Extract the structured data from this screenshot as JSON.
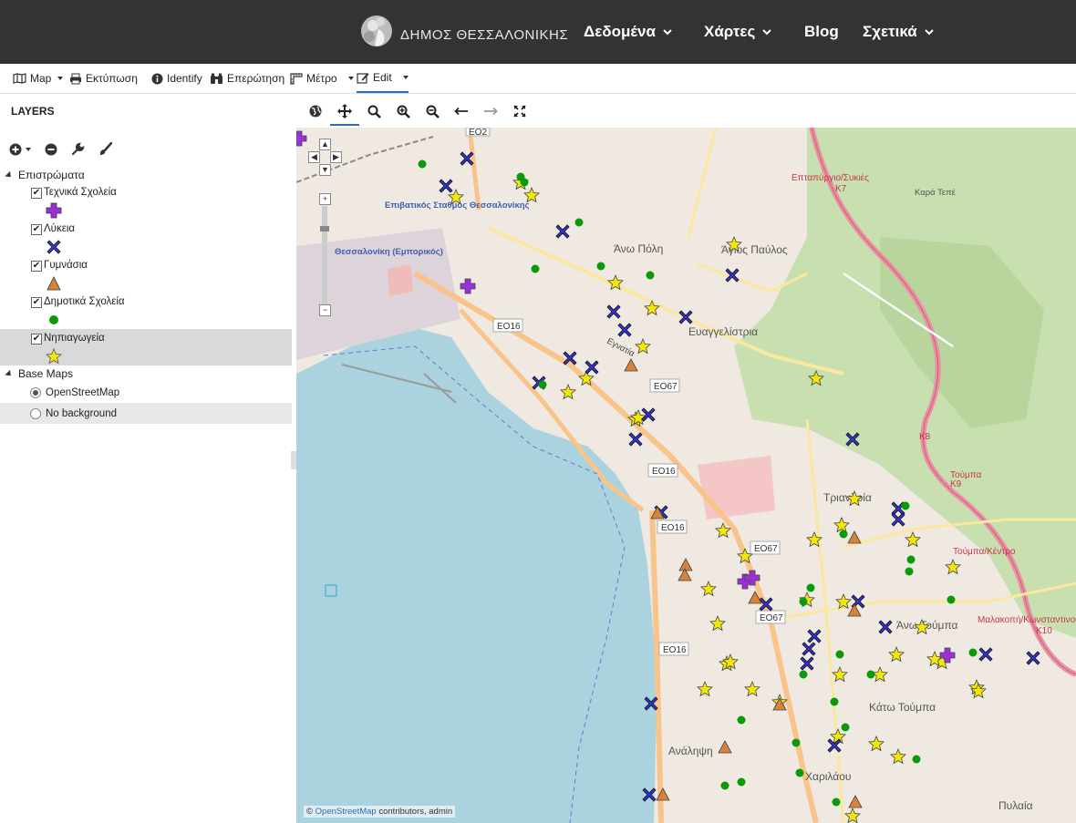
{
  "header": {
    "brand": "ΔΗΜΟΣ ΘΕΣΣΑΛΟΝΙΚΗΣ",
    "nav": [
      {
        "label": "Δεδομένα",
        "dropdown": true
      },
      {
        "label": "Χάρτες",
        "dropdown": true
      },
      {
        "label": "Blog",
        "dropdown": false
      },
      {
        "label": "Σχετικά",
        "dropdown": true
      }
    ]
  },
  "toolbar": {
    "map": "Map",
    "print": "Εκτύπωση",
    "identify": "Identify",
    "query": "Επερώτηση",
    "measure": "Μέτρο",
    "edit": "Edit"
  },
  "sidebar": {
    "title": "LAYERS",
    "overlays_group": "Επιστρώματα",
    "layers": [
      {
        "name": "Τεχνικά Σχολεία",
        "checked": true,
        "symbol": "plus",
        "color": "#9b30d9"
      },
      {
        "name": "Λύκεια",
        "checked": true,
        "symbol": "x",
        "color": "#3333cc"
      },
      {
        "name": "Γυμνάσια",
        "checked": true,
        "symbol": "triangle",
        "color": "#d9823b"
      },
      {
        "name": "Δημοτικά Σχολεία",
        "checked": true,
        "symbol": "circle",
        "color": "#0a9a0a"
      },
      {
        "name": "Νηπιαγωγεία",
        "checked": true,
        "symbol": "star",
        "color": "#f2e60a"
      }
    ],
    "basemaps_group": "Base Maps",
    "basemaps": [
      {
        "name": "OpenStreetMap",
        "selected": true
      },
      {
        "name": "No background",
        "selected": false
      }
    ]
  },
  "map": {
    "attribution_prefix": "©",
    "attribution_link": "OpenStreetMap",
    "attribution_suffix": " contributors, admin",
    "labels": {
      "station": "Επιβατικός Σταθμός Θεσσαλονίκης",
      "station_commercial": "Θεσσαλονίκη (Εμπορικός)",
      "ano_poli": "Άνω Πόλη",
      "agios_pavlos": "Άγιος Παύλος",
      "evangelistria": "Ευαγγελίστρια",
      "triandria": "Τριανδρία",
      "ano_toumpa": "Άνω Τούμπα",
      "kato_toumpa": "Κάτω Τούμπα",
      "analipsi": "Ανάληψη",
      "charilaou": "Χαριλάου",
      "pylaia": "Πυλαία",
      "eptapyrgio": "Επταπύργιο/Συκιές",
      "kara_tepe": "Καρά Τεπέ",
      "toumpa_k9": "Τούμπα",
      "toumpa_kentro": "Τούμπα/Κέντρο",
      "malakopi": "Μαλακοπή/Κωνσταντινουπόλεως",
      "egnatia": "Εγνατία",
      "eo16": "ΕΟ16",
      "eo67": "ΕΟ67",
      "eo2": "ΕΟ2",
      "k7": "Κ7",
      "k8": "Κ8",
      "k9": "Κ9",
      "k10": "Κ10"
    }
  }
}
